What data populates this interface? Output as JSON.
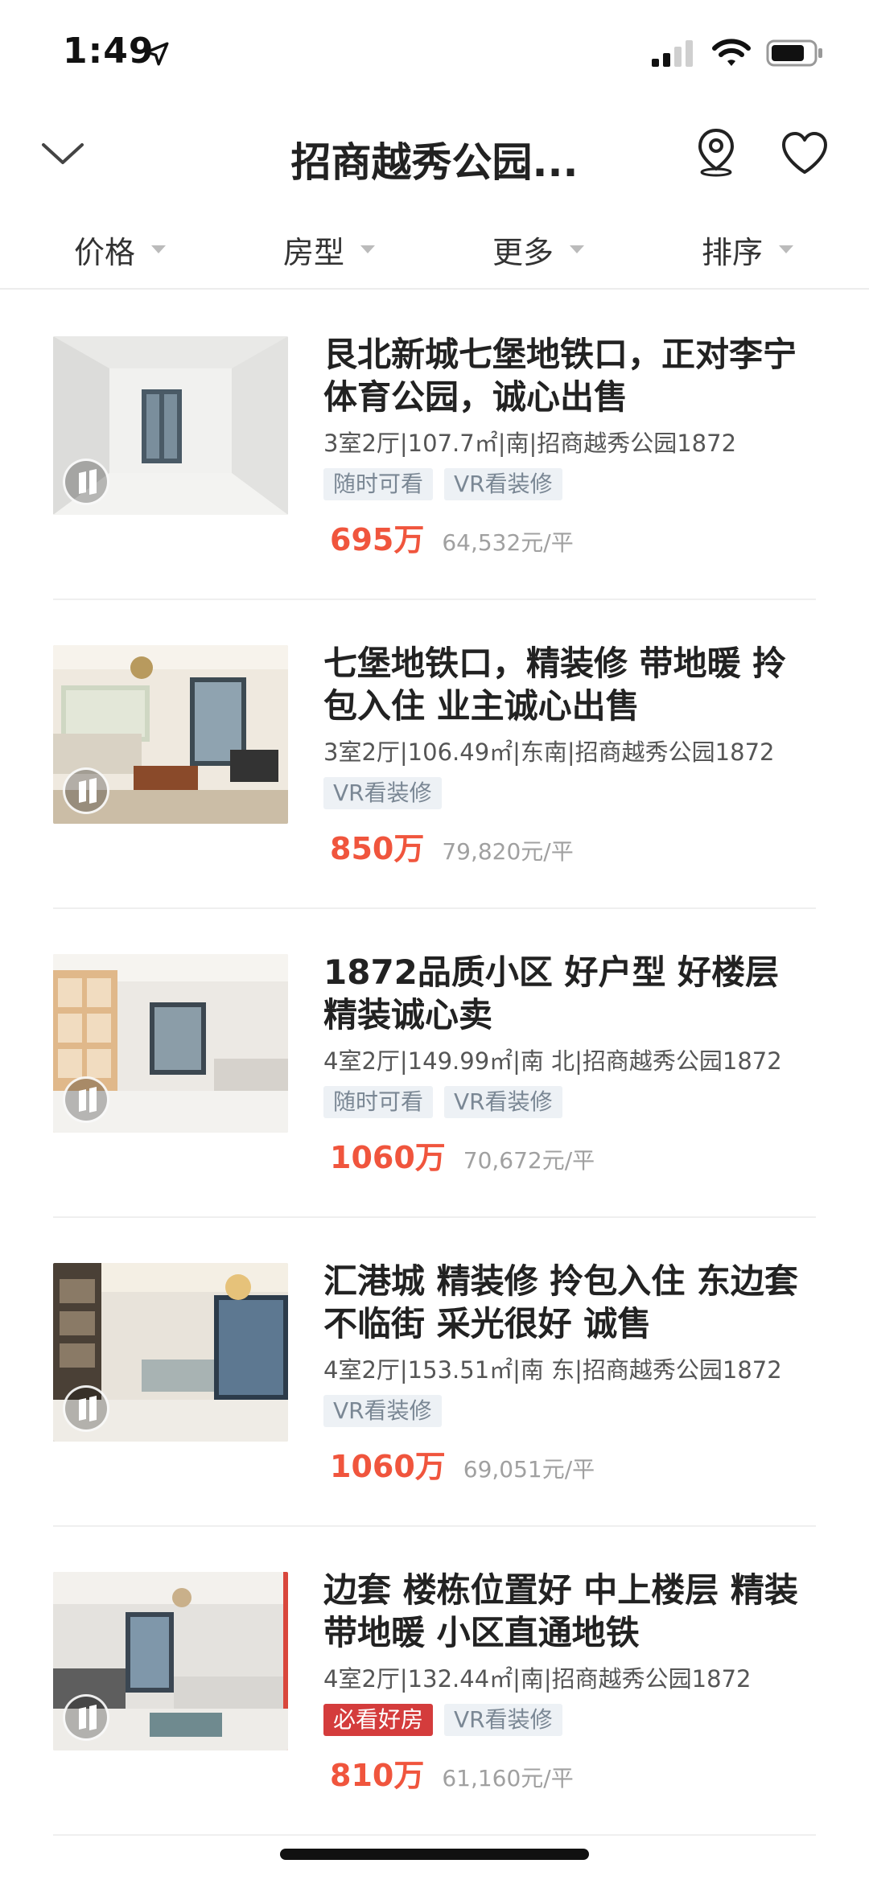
{
  "status_bar": {
    "time": "1:49"
  },
  "nav": {
    "title": "招商越秀公园..."
  },
  "filters": [
    {
      "label": "价格"
    },
    {
      "label": "房型"
    },
    {
      "label": "更多"
    },
    {
      "label": "排序"
    }
  ],
  "listings": [
    {
      "title": "艮北新城七堡地铁口，正对李宁体育公园，诚心出售",
      "meta": "3室2厅|107.7㎡|南|招商越秀公园1872",
      "tags": [
        "随时可看",
        "VR看装修"
      ],
      "price": "695万",
      "unit_price": "64,532元/平"
    },
    {
      "title": "七堡地铁口，精装修 带地暖 拎包入住 业主诚心出售",
      "meta": "3室2厅|106.49㎡|东南|招商越秀公园1872",
      "tags": [
        "VR看装修"
      ],
      "price": "850万",
      "unit_price": "79,820元/平"
    },
    {
      "title": "1872品质小区 好户型 好楼层 精装诚心卖",
      "meta": "4室2厅|149.99㎡|南 北|招商越秀公园1872",
      "tags": [
        "随时可看",
        "VR看装修"
      ],
      "price": "1060万",
      "unit_price": "70,672元/平"
    },
    {
      "title": "汇港城 精装修 拎包入住 东边套 不临街 采光很好 诚售",
      "meta": "4室2厅|153.51㎡|南 东|招商越秀公园1872",
      "tags": [
        "VR看装修"
      ],
      "price": "1060万",
      "unit_price": "69,051元/平"
    },
    {
      "title": "边套 楼栋位置好 中上楼层 精装带地暖 小区直通地铁",
      "meta": "4室2厅|132.44㎡|南|招商越秀公园1872",
      "tags": [
        "必看好房",
        "VR看装修"
      ],
      "price": "810万",
      "unit_price": "61,160元/平"
    }
  ],
  "colors": {
    "price": "#f0553d",
    "hot_tag": "#d43c3c",
    "tag_bg": "#edf1f5"
  }
}
